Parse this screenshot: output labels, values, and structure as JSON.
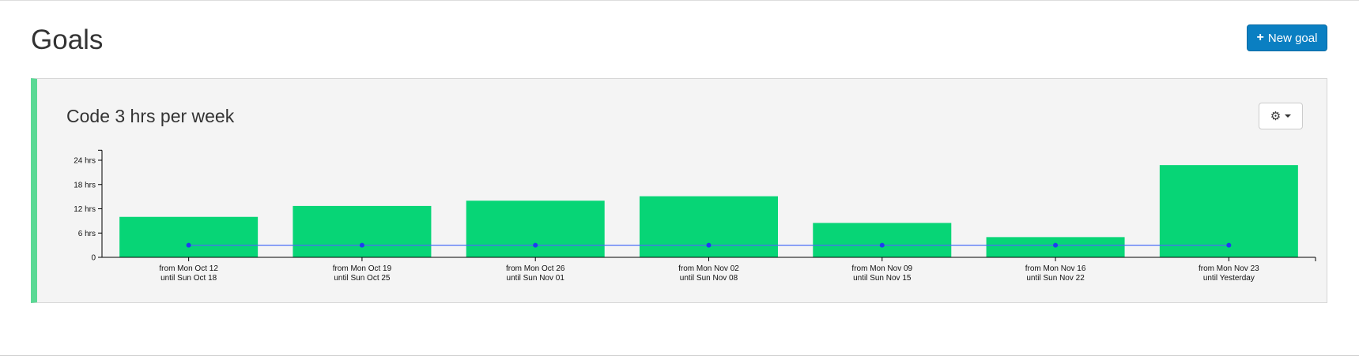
{
  "header": {
    "title": "Goals",
    "new_goal_label": "New goal"
  },
  "goal": {
    "title": "Code 3 hrs per week",
    "bar_color": "#07d576",
    "accent_color": "#5ad995",
    "target_line_color": "#4a6cf7"
  },
  "chart_data": {
    "type": "bar",
    "categories": [
      [
        "from Mon Oct 12",
        "until Sun Oct 18"
      ],
      [
        "from Mon Oct 19",
        "until Sun Oct 25"
      ],
      [
        "from Mon Oct 26",
        "until Sun Nov 01"
      ],
      [
        "from Mon Nov 02",
        "until Sun Nov 08"
      ],
      [
        "from Mon Nov 09",
        "until Sun Nov 15"
      ],
      [
        "from Mon Nov 16",
        "until Sun Nov 22"
      ],
      [
        "from Mon Nov 23",
        "until Yesterday"
      ]
    ],
    "values": [
      10,
      12.7,
      14,
      15.1,
      8.5,
      5,
      22.8
    ],
    "target": 3,
    "ylim": [
      0,
      25.5
    ],
    "yticks": [
      0,
      6,
      12,
      18,
      24
    ],
    "ytick_labels": [
      "0",
      "6 hrs",
      "12 hrs",
      "18 hrs",
      "24 hrs"
    ]
  }
}
